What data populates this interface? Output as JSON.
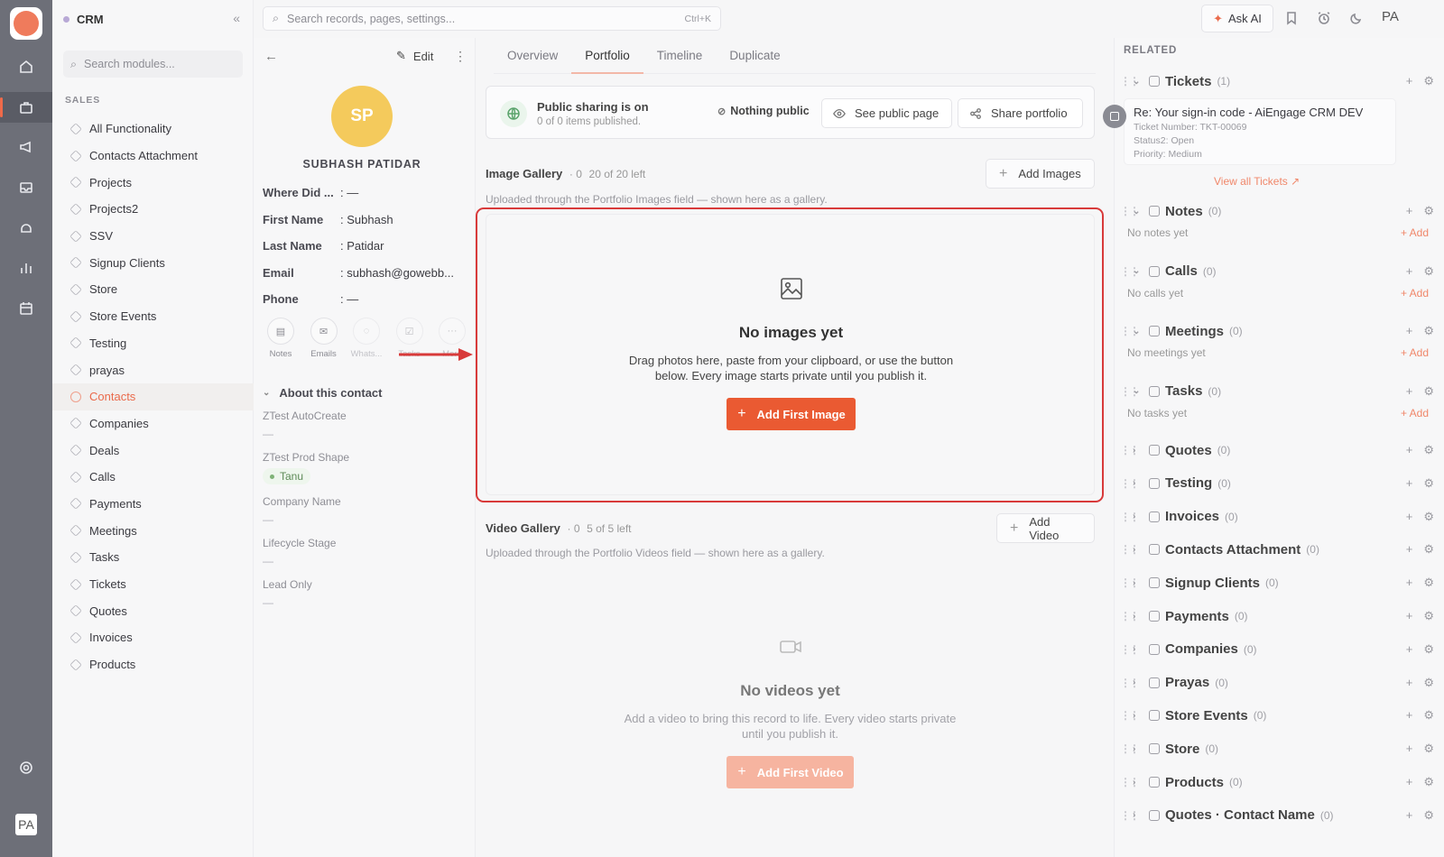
{
  "app": {
    "name": "CRM"
  },
  "topbar": {
    "search_placeholder": "Search records, pages, settings...",
    "shortcut": "Ctrl+K",
    "ask_ai": "Ask AI",
    "user_initials": "PA"
  },
  "rail": {
    "user_initials": "PA"
  },
  "modules": {
    "search_placeholder": "Search modules...",
    "section": "SALES",
    "items": [
      "All Functionality",
      "Contacts Attachment",
      "Projects",
      "Projects2",
      "SSV",
      "Signup Clients",
      "Store",
      "Store Events",
      "Testing",
      "prayas",
      "Contacts",
      "Companies",
      "Deals",
      "Calls",
      "Payments",
      "Meetings",
      "Tasks",
      "Tickets",
      "Quotes",
      "Invoices",
      "Products"
    ],
    "active": "Contacts"
  },
  "contact": {
    "edit_label": "Edit",
    "initials": "SP",
    "name": "SUBHASH PATIDAR",
    "fields": [
      {
        "label": "Where Did ...",
        "value": ": —"
      },
      {
        "label": "First Name",
        "value": ": Subhash"
      },
      {
        "label": "Last Name",
        "value": ": Patidar"
      },
      {
        "label": "Email",
        "value": ": subhash@gowebb..."
      },
      {
        "label": "Phone",
        "value": ": —"
      }
    ],
    "actions": [
      "Notes",
      "Emails",
      "Whats...",
      "Tasks",
      "More"
    ],
    "about_title": "About this contact",
    "about": [
      {
        "label": "ZTest AutoCreate",
        "value": "—"
      },
      {
        "label": "ZTest Prod Shape",
        "chip": "Tanu"
      },
      {
        "label": "Company Name",
        "value": "—"
      },
      {
        "label": "Lifecycle Stage",
        "value": "—"
      },
      {
        "label": "Lead Only",
        "value": "—"
      }
    ]
  },
  "tabs": [
    "Overview",
    "Portfolio",
    "Timeline",
    "Duplicate"
  ],
  "active_tab": "Portfolio",
  "sharing": {
    "title": "Public sharing is on",
    "subtitle": "0 of 0 items published.",
    "nothing_public": "Nothing public",
    "see_public": "See public page",
    "share": "Share portfolio"
  },
  "image_gallery": {
    "title": "Image Gallery",
    "count": "· 0",
    "left": "20 of 20 left",
    "add": "Add Images",
    "subtitle": "Uploaded through the Portfolio Images field — shown here as a gallery.",
    "empty_title": "No images yet",
    "empty_desc": "Drag photos here, paste from your clipboard, or use the button below. Every image starts private until you publish it.",
    "cta": "Add First Image"
  },
  "video_gallery": {
    "title": "Video Gallery",
    "count": "· 0",
    "left": "5 of 5 left",
    "add": "Add Video",
    "subtitle": "Uploaded through the Portfolio Videos field — shown here as a gallery.",
    "empty_title": "No videos yet",
    "empty_desc": "Add a video to bring this record to life. Every video starts private until you publish it.",
    "cta": "Add First Video"
  },
  "related": {
    "heading": "RELATED",
    "tickets": {
      "label": "Tickets",
      "count": "(1)"
    },
    "ticket": {
      "title": "Re: Your sign-in code - AiEngage CRM DEV",
      "number": "Ticket Number: TKT-00069",
      "status": "Status2: Open",
      "priority": "Priority: Medium",
      "view_all": "View all Tickets"
    },
    "add_label": "+ Add",
    "expandable": [
      {
        "label": "Notes",
        "count": "(0)",
        "empty": "No notes yet"
      },
      {
        "label": "Calls",
        "count": "(0)",
        "empty": "No calls yet"
      },
      {
        "label": "Meetings",
        "count": "(0)",
        "empty": "No meetings yet"
      },
      {
        "label": "Tasks",
        "count": "(0)",
        "empty": "No tasks yet"
      }
    ],
    "collapsed": [
      {
        "label": "Quotes",
        "count": "(0)"
      },
      {
        "label": "Testing",
        "count": "(0)"
      },
      {
        "label": "Invoices",
        "count": "(0)"
      },
      {
        "label": "Contacts Attachment",
        "count": "(0)"
      },
      {
        "label": "Signup Clients",
        "count": "(0)"
      },
      {
        "label": "Payments",
        "count": "(0)"
      },
      {
        "label": "Companies",
        "count": "(0)"
      },
      {
        "label": "Prayas",
        "count": "(0)"
      },
      {
        "label": "Store Events",
        "count": "(0)"
      },
      {
        "label": "Store",
        "count": "(0)"
      },
      {
        "label": "Products",
        "count": "(0)"
      },
      {
        "label": "Quotes · Contact Name",
        "count": "(0)"
      }
    ]
  }
}
